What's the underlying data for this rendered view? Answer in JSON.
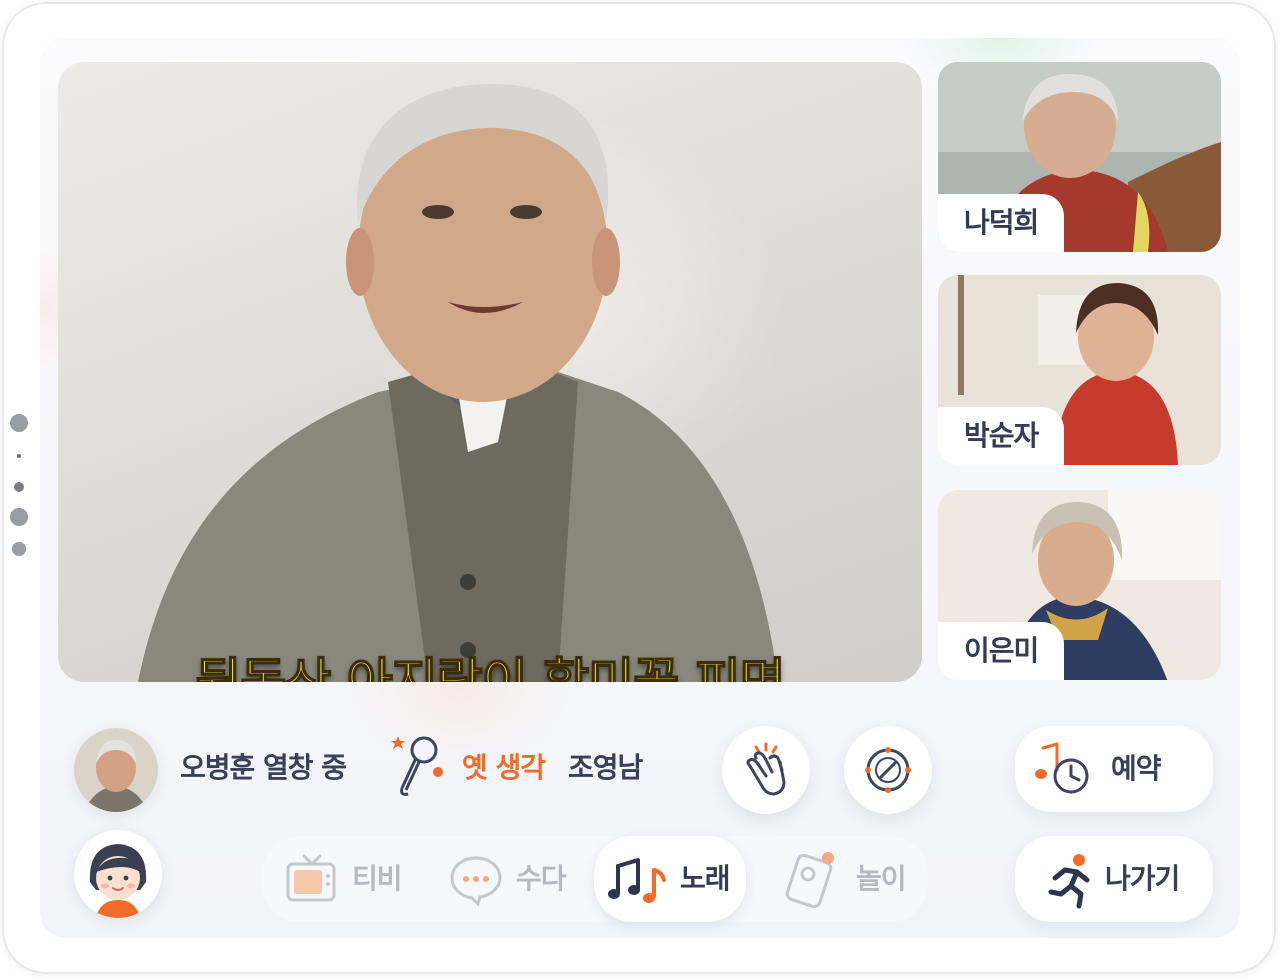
{
  "main_video": {
    "caption": "뒷동산 아지랑이 할미꽃 피면"
  },
  "participants": [
    {
      "name": "나덕희"
    },
    {
      "name": "박순자"
    },
    {
      "name": "이은미"
    }
  ],
  "now_playing": {
    "singer_status": "오병훈 열창 중",
    "song_title": "옛 생각",
    "artist": "조영남",
    "colors": {
      "accent": "#f26b2a",
      "text": "#3a4058"
    }
  },
  "actions": {
    "clap_icon": "clap-icon",
    "tambourine_icon": "tambourine-icon",
    "reserve_label": "예약",
    "exit_label": "나가기"
  },
  "nav": {
    "items": [
      {
        "label": "티비",
        "icon": "tv-icon"
      },
      {
        "label": "수다",
        "icon": "chat-icon"
      },
      {
        "label": "노래",
        "icon": "music-icon",
        "active": true
      },
      {
        "label": "놀이",
        "icon": "game-icon"
      }
    ]
  }
}
